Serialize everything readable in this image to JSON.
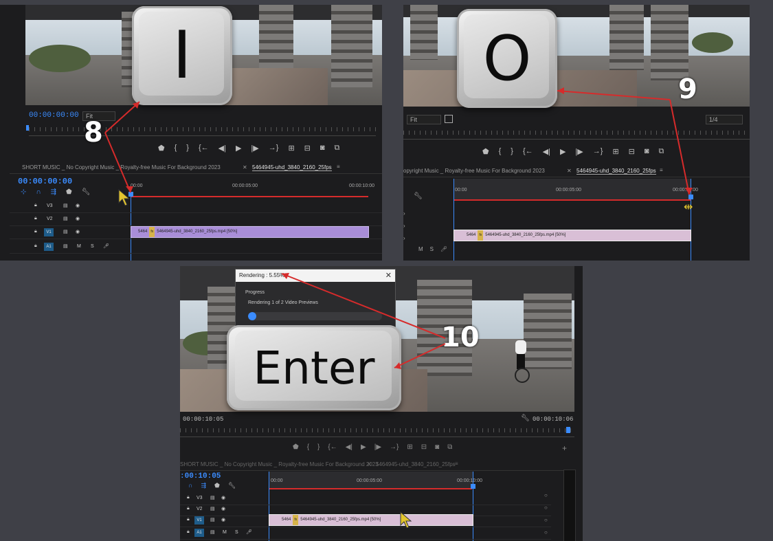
{
  "colors": {
    "accent": "#3b8cff",
    "annotation": "#d62b2b",
    "clip_purple": "#a98ed8",
    "clip_pink": "#d9bfd6",
    "background": "#3f4047"
  },
  "panel1": {
    "key": "I",
    "step": "8",
    "timecode": "00:00:00:00",
    "fit": "Fit",
    "seq_timecode": "00:00:00:00",
    "seq_tab_music": "SHORT MUSIC _ No Copyright Music _ Royalty-free Music For Background 2023",
    "seq_tab_active": "5464945-uhd_3840_2160_25fps",
    "ruler": [
      "00:00",
      "00:00:05:00",
      "00:00:10:00"
    ],
    "tracks": [
      "V3",
      "V2",
      "V1",
      "A1"
    ],
    "clip_short": "5464",
    "clip_name": "5464945-uhd_3840_2160_25fps.mp4 [50%]"
  },
  "panel2": {
    "key": "O",
    "step": "9",
    "fit": "Fit",
    "quality": "1/4",
    "seq_tab_music": "opyright Music _ Royalty-free Music For Background 2023",
    "seq_tab_active": "5464945-uhd_3840_2160_25fps",
    "ruler": [
      "00:00",
      "00:00:05:00",
      "00:00:10:00"
    ],
    "clip_short": "5464",
    "clip_name": "5464945-uhd_3840_2160_25fps.mp4 [50%]"
  },
  "panel3": {
    "key": "Enter",
    "step": "10",
    "dialog_title": "Rendering : 5.55%",
    "dialog_section": "Progress",
    "dialog_status": "Rendering 1 of 2 Video Previews",
    "progress": 0.0555,
    "timecode_left": "00:00:10:05",
    "timecode_right": "00:00:10:06",
    "seq_timecode": ":00:10:05",
    "seq_tab_music": "SHORT MUSIC _ No Copyright Music _ Royalty-free Music For Background 2023",
    "seq_tab_active": "5464945-uhd_3840_2160_25fps",
    "ruler": [
      "00:00",
      "00:00:05:00",
      "00:00:10:00"
    ],
    "tracks": [
      "V3",
      "V2",
      "V1",
      "A1"
    ],
    "clip_short": "5464",
    "clip_name": "5464945-uhd_3840_2160_25fps.mp4 [50%]"
  }
}
